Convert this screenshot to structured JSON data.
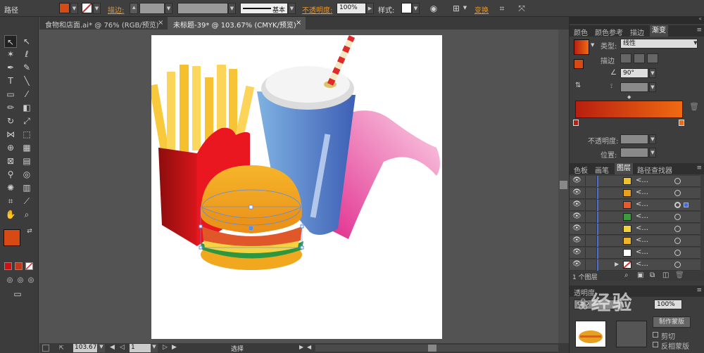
{
  "control_bar": {
    "object_type": "路径",
    "stroke_label": "描边:",
    "stroke_style": "基本",
    "opacity_label": "不透明度:",
    "opacity_value": "100%",
    "style_label": "样式:",
    "transform_label": "变换",
    "fill_color": "#d84a14"
  },
  "doc_tabs": [
    {
      "label": "食物和店面.ai* @ 76% (RGB/预览)"
    },
    {
      "label": "未标题-39* @ 103.67% (CMYK/预览)"
    }
  ],
  "status": {
    "zoom": "103.67",
    "artboard": "1",
    "tool": "选择"
  },
  "gradient_panel": {
    "tabs": [
      "颜色",
      "颜色参考",
      "描边",
      "渐变"
    ],
    "type_label": "类型:",
    "type_value": "线性",
    "stroke_label": "描边",
    "angle_value": "90°",
    "opacity_label": "不透明度:",
    "location_label": "位置:",
    "start_color": "#b81f10",
    "end_color": "#f06a12"
  },
  "layers_panel": {
    "tabs": [
      "色板",
      "画笔",
      "图层",
      "路径查找器"
    ],
    "row_label": "<...",
    "layer_count": "1 个图层",
    "rows": [
      {
        "thumb": "#f2c028"
      },
      {
        "thumb": "#e8a020"
      },
      {
        "thumb": "#e85a2a"
      },
      {
        "thumb": "#3d9a3d"
      },
      {
        "thumb": "#f2d23a"
      },
      {
        "thumb": "#f0b428"
      },
      {
        "thumb": "#ffffff"
      },
      {
        "thumb": "#e23030"
      }
    ]
  },
  "transparency_panel": {
    "title": "透明度",
    "mode": "正常",
    "opacity": "100%",
    "make_mask": "制作蒙版",
    "clip": "剪切",
    "invert": "反相蒙版"
  },
  "watermark": {
    "text": "经验"
  }
}
